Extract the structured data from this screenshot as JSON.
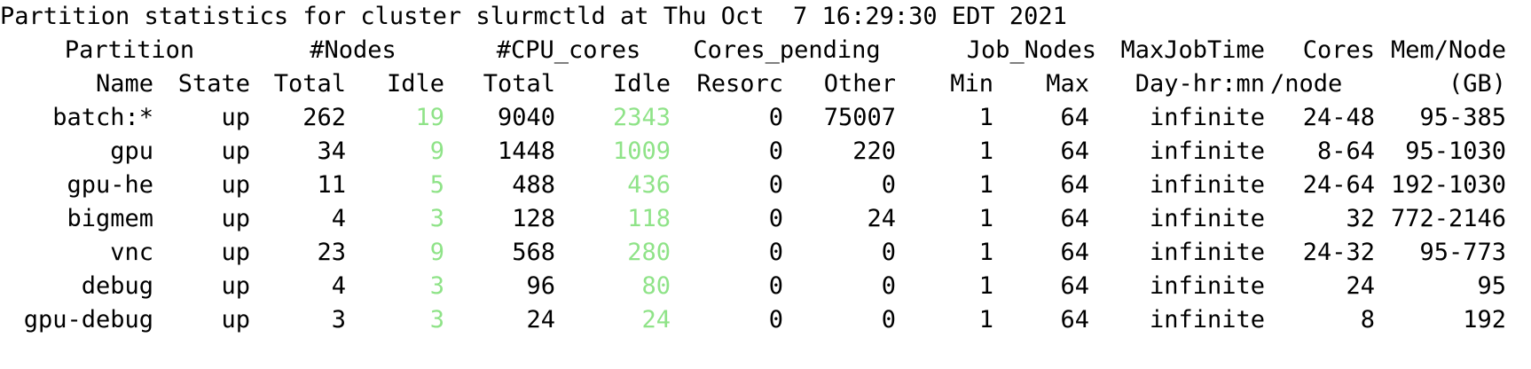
{
  "title": "Partition statistics for cluster slurmctld at Thu Oct  7 16:29:30 EDT 2021",
  "header_top": {
    "partition": "Partition",
    "nodes": "#Nodes",
    "cpu_cores": "#CPU_cores",
    "cores_pending": "Cores_pending",
    "job_nodes": "Job_Nodes",
    "max_job_time": "MaxJobTime",
    "cores": "Cores",
    "mem_node": "Mem/Node"
  },
  "header_bottom": {
    "name": "Name",
    "state": "State",
    "nodes_total": "Total",
    "nodes_idle": "Idle",
    "cpu_total": "Total",
    "cpu_idle": "Idle",
    "resorc": "Resorc",
    "other": "Other",
    "min": "Min",
    "max": "Max",
    "day_hr_mn": "Day-hr:mn",
    "per_node": "/node",
    "gb": "(GB)"
  },
  "idle_color": "#8fe388",
  "rows": [
    {
      "name": "batch:*",
      "state": "up",
      "nodes_total": "262",
      "nodes_idle": "19",
      "cpu_total": "9040",
      "cpu_idle": "2343",
      "resorc": "0",
      "other": "75007",
      "min": "1",
      "max": "64",
      "max_job_time": "infinite",
      "cores_node": "24-48",
      "mem_node": "95-385"
    },
    {
      "name": "gpu",
      "state": "up",
      "nodes_total": "34",
      "nodes_idle": "9",
      "cpu_total": "1448",
      "cpu_idle": "1009",
      "resorc": "0",
      "other": "220",
      "min": "1",
      "max": "64",
      "max_job_time": "infinite",
      "cores_node": "8-64",
      "mem_node": "95-1030"
    },
    {
      "name": "gpu-he",
      "state": "up",
      "nodes_total": "11",
      "nodes_idle": "5",
      "cpu_total": "488",
      "cpu_idle": "436",
      "resorc": "0",
      "other": "0",
      "min": "1",
      "max": "64",
      "max_job_time": "infinite",
      "cores_node": "24-64",
      "mem_node": "192-1030"
    },
    {
      "name": "bigmem",
      "state": "up",
      "nodes_total": "4",
      "nodes_idle": "3",
      "cpu_total": "128",
      "cpu_idle": "118",
      "resorc": "0",
      "other": "24",
      "min": "1",
      "max": "64",
      "max_job_time": "infinite",
      "cores_node": "32",
      "mem_node": "772-2146"
    },
    {
      "name": "vnc",
      "state": "up",
      "nodes_total": "23",
      "nodes_idle": "9",
      "cpu_total": "568",
      "cpu_idle": "280",
      "resorc": "0",
      "other": "0",
      "min": "1",
      "max": "64",
      "max_job_time": "infinite",
      "cores_node": "24-32",
      "mem_node": "95-773"
    },
    {
      "name": "debug",
      "state": "up",
      "nodes_total": "4",
      "nodes_idle": "3",
      "cpu_total": "96",
      "cpu_idle": "80",
      "resorc": "0",
      "other": "0",
      "min": "1",
      "max": "64",
      "max_job_time": "infinite",
      "cores_node": "24",
      "mem_node": "95"
    },
    {
      "name": "gpu-debug",
      "state": "up",
      "nodes_total": "3",
      "nodes_idle": "3",
      "cpu_total": "24",
      "cpu_idle": "24",
      "resorc": "0",
      "other": "0",
      "min": "1",
      "max": "64",
      "max_job_time": "infinite",
      "cores_node": "8",
      "mem_node": "192"
    }
  ]
}
